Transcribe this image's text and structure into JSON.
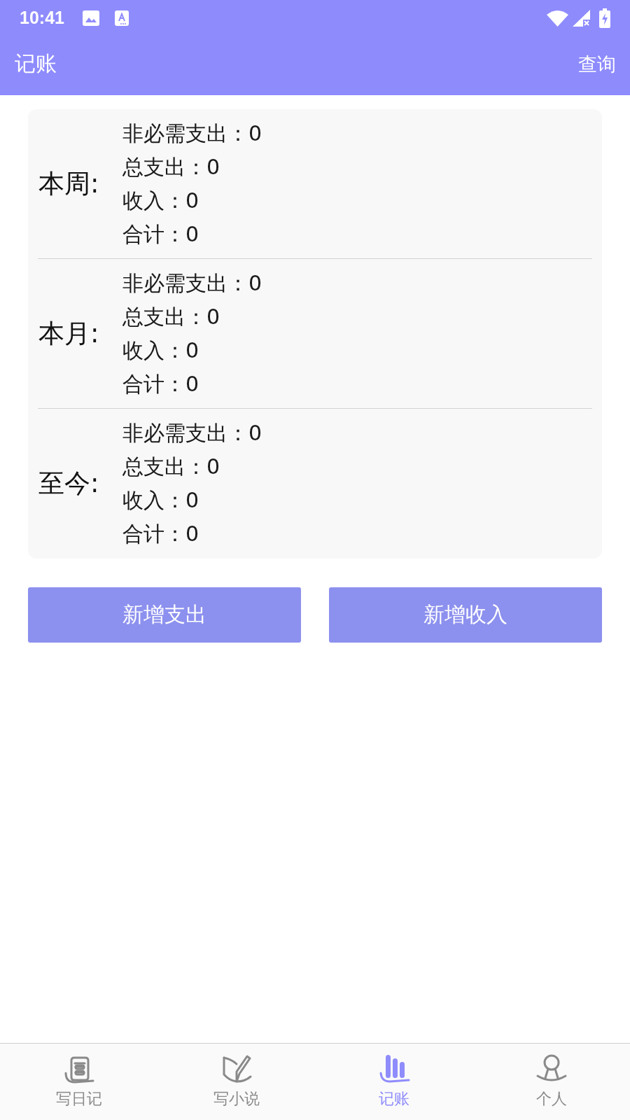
{
  "status_bar": {
    "time": "10:41"
  },
  "app_bar": {
    "title": "记账",
    "action": "查询"
  },
  "summary": [
    {
      "period": "本周:",
      "lines": [
        "非必需支出：0",
        "总支出：0",
        "收入：0",
        "合计：0"
      ]
    },
    {
      "period": "本月:",
      "lines": [
        "非必需支出：0",
        "总支出：0",
        "收入：0",
        "合计：0"
      ]
    },
    {
      "period": "至今:",
      "lines": [
        "非必需支出：0",
        "总支出：0",
        "收入：0",
        "合计：0"
      ]
    }
  ],
  "buttons": [
    "新增支出",
    "新增收入"
  ],
  "bottom_nav": [
    {
      "kind": "diary",
      "label": "写日记",
      "selected": false
    },
    {
      "kind": "novel",
      "label": "写小说",
      "selected": false
    },
    {
      "kind": "ledger",
      "label": "记账",
      "selected": true
    },
    {
      "kind": "person",
      "label": "个人",
      "selected": false
    }
  ]
}
